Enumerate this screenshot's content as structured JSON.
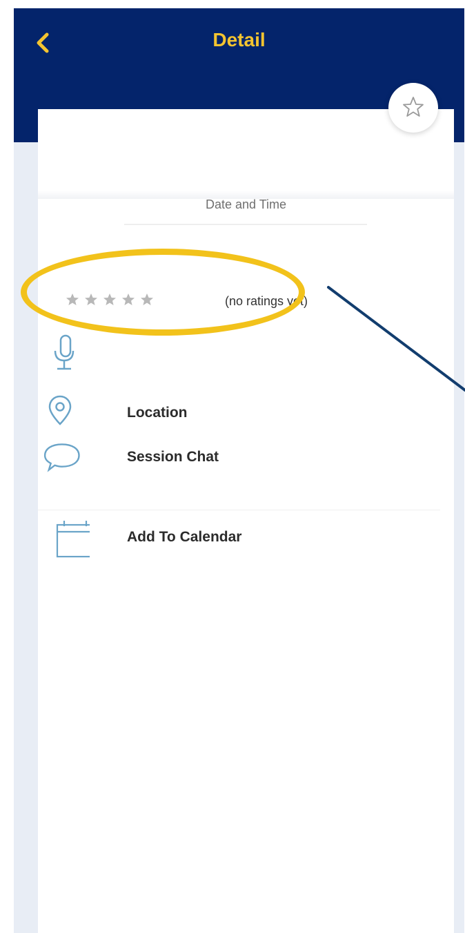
{
  "header": {
    "title": "Detail",
    "back_icon": "chevron-left-icon"
  },
  "session": {
    "date_time_label": "Date and Time",
    "favorite_icon": "star-outline-icon"
  },
  "rating": {
    "star_count": 5,
    "value": 0,
    "text": "(no ratings yet)"
  },
  "menu": [
    {
      "icon": "microphone-icon",
      "label": ""
    },
    {
      "icon": "map-pin-icon",
      "label": "Location"
    },
    {
      "icon": "chat-bubble-icon",
      "label": "Session Chat"
    },
    {
      "icon": "calendar-icon",
      "label": "Add To Calendar"
    }
  ],
  "colors": {
    "brand": "#04246b",
    "accent": "#f4c430",
    "icon": "#6aa4c8",
    "highlight": "#f2c21b",
    "pointer": "#123d6e"
  }
}
